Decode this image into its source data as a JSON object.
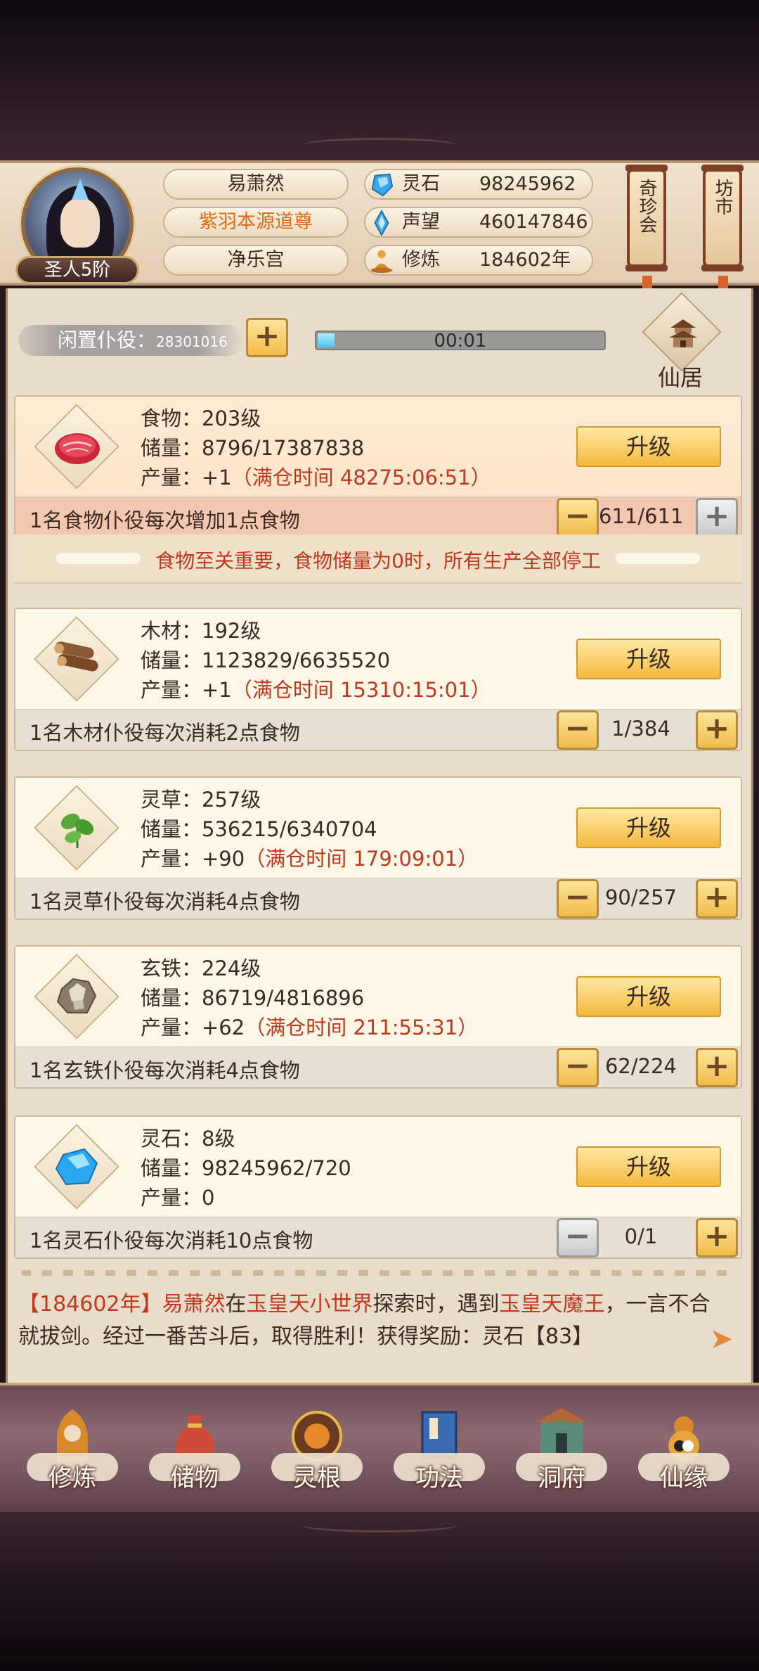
{
  "player": {
    "name": "易萧然",
    "title": "紫羽本源道尊",
    "palace": "净乐宫",
    "rank": "圣人5阶"
  },
  "stats": [
    {
      "icon": "spirit-stone-icon",
      "label": "灵石",
      "value": "98245962"
    },
    {
      "icon": "prestige-icon",
      "label": "声望",
      "value": "460147846"
    },
    {
      "icon": "cultivation-icon",
      "label": "修炼",
      "value": "184602年"
    }
  ],
  "scrolls": [
    {
      "label": "奇珍会"
    },
    {
      "label": "坊市"
    }
  ],
  "idle": {
    "label": "闲置仆役",
    "count": "28301016",
    "timer": "00:01",
    "timer_progress": 0.06
  },
  "residence": {
    "label": "仙居"
  },
  "resources": [
    {
      "name": "食物",
      "level": "食物：203级",
      "storage": "储量：8796/17387838",
      "output": "产量：+1",
      "full_time": "（满仓时间 48275:06:51）",
      "upgrade": "升级",
      "note": "1名食物仆役每次增加1点食物",
      "count": "611/611"
    },
    {
      "name": "木材",
      "level": "木材：192级",
      "storage": "储量：1123829/6635520",
      "output": "产量：+1",
      "full_time": "（满仓时间 15310:15:01）",
      "upgrade": "升级",
      "note": "1名木材仆役每次消耗2点食物",
      "count": "1/384"
    },
    {
      "name": "灵草",
      "level": "灵草：257级",
      "storage": "储量：536215/6340704",
      "output": "产量：+90",
      "full_time": "（满仓时间 179:09:01）",
      "upgrade": "升级",
      "note": "1名灵草仆役每次消耗4点食物",
      "count": "90/257"
    },
    {
      "name": "玄铁",
      "level": "玄铁：224级",
      "storage": "储量：86719/4816896",
      "output": "产量：+62",
      "full_time": "（满仓时间 211:55:31）",
      "upgrade": "升级",
      "note": "1名玄铁仆役每次消耗4点食物",
      "count": "62/224"
    },
    {
      "name": "灵石",
      "level": "灵石：8级",
      "storage": "储量：98245962/720",
      "output": "产量：0",
      "full_time": "",
      "upgrade": "升级",
      "note": "1名灵石仆役每次消耗10点食物",
      "count": "0/1"
    }
  ],
  "warning": "食物至关重要，食物储量为0时，所有生产全部停工",
  "log": {
    "year": "【184602年】",
    "name": "易萧然",
    "t1": "在",
    "place": "玉皇天小世界",
    "t2": "探索时，遇到",
    "enemy": "玉皇天魔王",
    "t3": "，一言不合就拔剑。经过一番苦斗后，取得胜利！获得奖励：灵石【83】"
  },
  "nav": [
    {
      "label": "修炼",
      "icon": "cultivate-icon"
    },
    {
      "label": "储物",
      "icon": "storage-bag-icon"
    },
    {
      "label": "灵根",
      "icon": "spirit-root-icon"
    },
    {
      "label": "功法",
      "icon": "technique-book-icon"
    },
    {
      "label": "洞府",
      "icon": "cave-mansion-icon"
    },
    {
      "label": "仙缘",
      "icon": "immortal-fate-icon"
    }
  ],
  "colors": {
    "accent_red": "#c0381e",
    "gold_button": "#f3b93e",
    "title_orange": "#e06a14",
    "progress_blue": "#4fc3ea"
  }
}
